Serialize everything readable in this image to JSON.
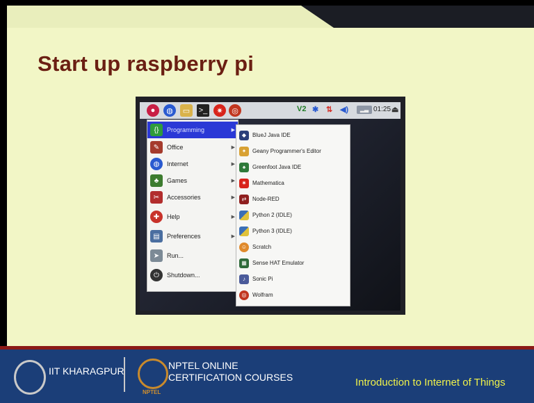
{
  "slide": {
    "title": "Start up raspberry pi"
  },
  "taskbar": {
    "icons": [
      "raspberry-icon",
      "globe-icon",
      "folder-icon",
      "terminal-icon",
      "mathematica-icon",
      "wolfram-icon"
    ],
    "tray": {
      "vnc": "V2",
      "clock": "01:25"
    }
  },
  "menu": {
    "items": [
      {
        "label": "Programming",
        "selected": true
      },
      {
        "label": "Office"
      },
      {
        "label": "Internet"
      },
      {
        "label": "Games"
      },
      {
        "label": "Accessories"
      },
      {
        "label": "Help"
      },
      {
        "label": "Preferences"
      },
      {
        "label": "Run..."
      },
      {
        "label": "Shutdown..."
      }
    ]
  },
  "submenu": {
    "items": [
      {
        "label": "BlueJ Java IDE"
      },
      {
        "label": "Geany Programmer's Editor"
      },
      {
        "label": "Greenfoot Java IDE"
      },
      {
        "label": "Mathematica"
      },
      {
        "label": "Node-RED"
      },
      {
        "label": "Python 2 (IDLE)"
      },
      {
        "label": "Python 3 (IDLE)"
      },
      {
        "label": "Scratch"
      },
      {
        "label": "Sense HAT Emulator"
      },
      {
        "label": "Sonic Pi"
      },
      {
        "label": "Wolfram"
      }
    ]
  },
  "footer": {
    "institute": "IIT KHARAGPUR",
    "nptel_mark": "NPTEL",
    "nptel_line1": "NPTEL ONLINE",
    "nptel_line2": "CERTIFICATION COURSES",
    "course": "Introduction to Internet of Things"
  },
  "colors": {
    "slide_bg": "#f2f6c6",
    "title": "#6b1f13",
    "footer_bg": "#1b3e78",
    "footer_accent": "#8b1a17",
    "course_text": "#f0f24a",
    "menu_selected": "#2b39d6"
  }
}
